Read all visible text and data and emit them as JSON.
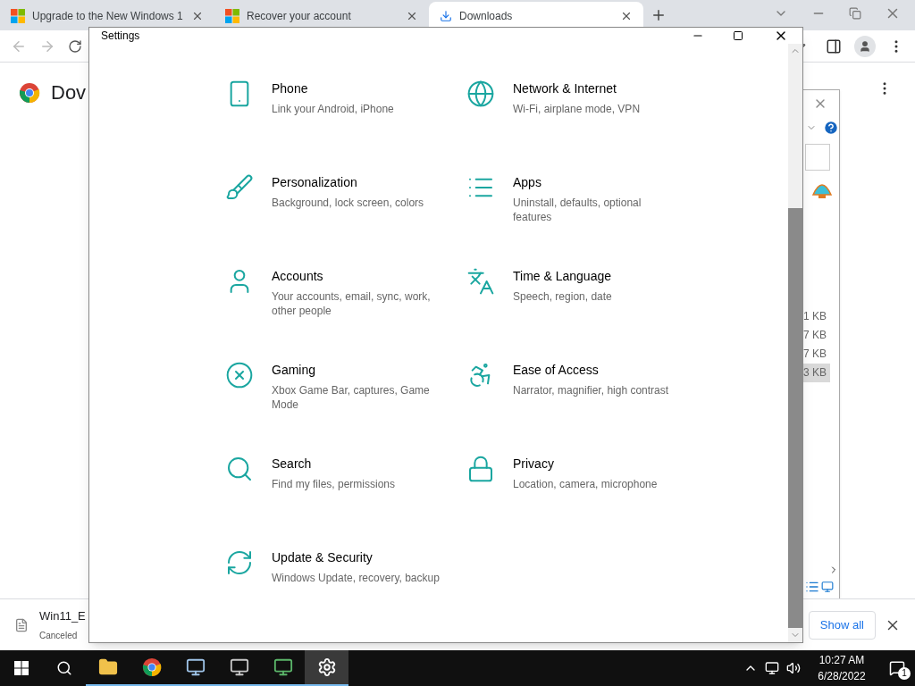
{
  "browser": {
    "tabs": [
      {
        "title": "Upgrade to the New Windows 1",
        "selected": false
      },
      {
        "title": "Recover your account",
        "selected": false
      },
      {
        "title": "Downloads",
        "selected": true
      }
    ],
    "page_title": "Dov",
    "download": {
      "file": "Win11_E",
      "status": "Canceled"
    },
    "show_all": "Show all"
  },
  "explorer": {
    "sizes": [
      {
        "text": "1 KB",
        "selected": false
      },
      {
        "text": "7 KB",
        "selected": false
      },
      {
        "text": "7 KB",
        "selected": false
      },
      {
        "text": "3 KB",
        "selected": true
      }
    ]
  },
  "settings": {
    "title": "Settings",
    "items": [
      {
        "title": "Phone",
        "subtitle": "Link your Android, iPhone"
      },
      {
        "title": "Network & Internet",
        "subtitle": "Wi-Fi, airplane mode, VPN"
      },
      {
        "title": "Personalization",
        "subtitle": "Background, lock screen, colors"
      },
      {
        "title": "Apps",
        "subtitle": "Uninstall, defaults, optional features"
      },
      {
        "title": "Accounts",
        "subtitle": "Your accounts, email, sync, work, other people"
      },
      {
        "title": "Time & Language",
        "subtitle": "Speech, region, date"
      },
      {
        "title": "Gaming",
        "subtitle": "Xbox Game Bar, captures, Game Mode"
      },
      {
        "title": "Ease of Access",
        "subtitle": "Narrator, magnifier, high contrast"
      },
      {
        "title": "Search",
        "subtitle": "Find my files, permissions"
      },
      {
        "title": "Privacy",
        "subtitle": "Location, camera, microphone"
      },
      {
        "title": "Update & Security",
        "subtitle": "Windows Update, recovery, backup"
      }
    ]
  },
  "taskbar": {
    "apps": [
      {
        "selected": false
      },
      {
        "selected": false
      },
      {
        "selected": false
      },
      {
        "selected": false
      },
      {
        "selected": false
      },
      {
        "selected": true
      }
    ],
    "time": "10:27 AM",
    "date": "6/28/2022",
    "notifications": "1"
  }
}
